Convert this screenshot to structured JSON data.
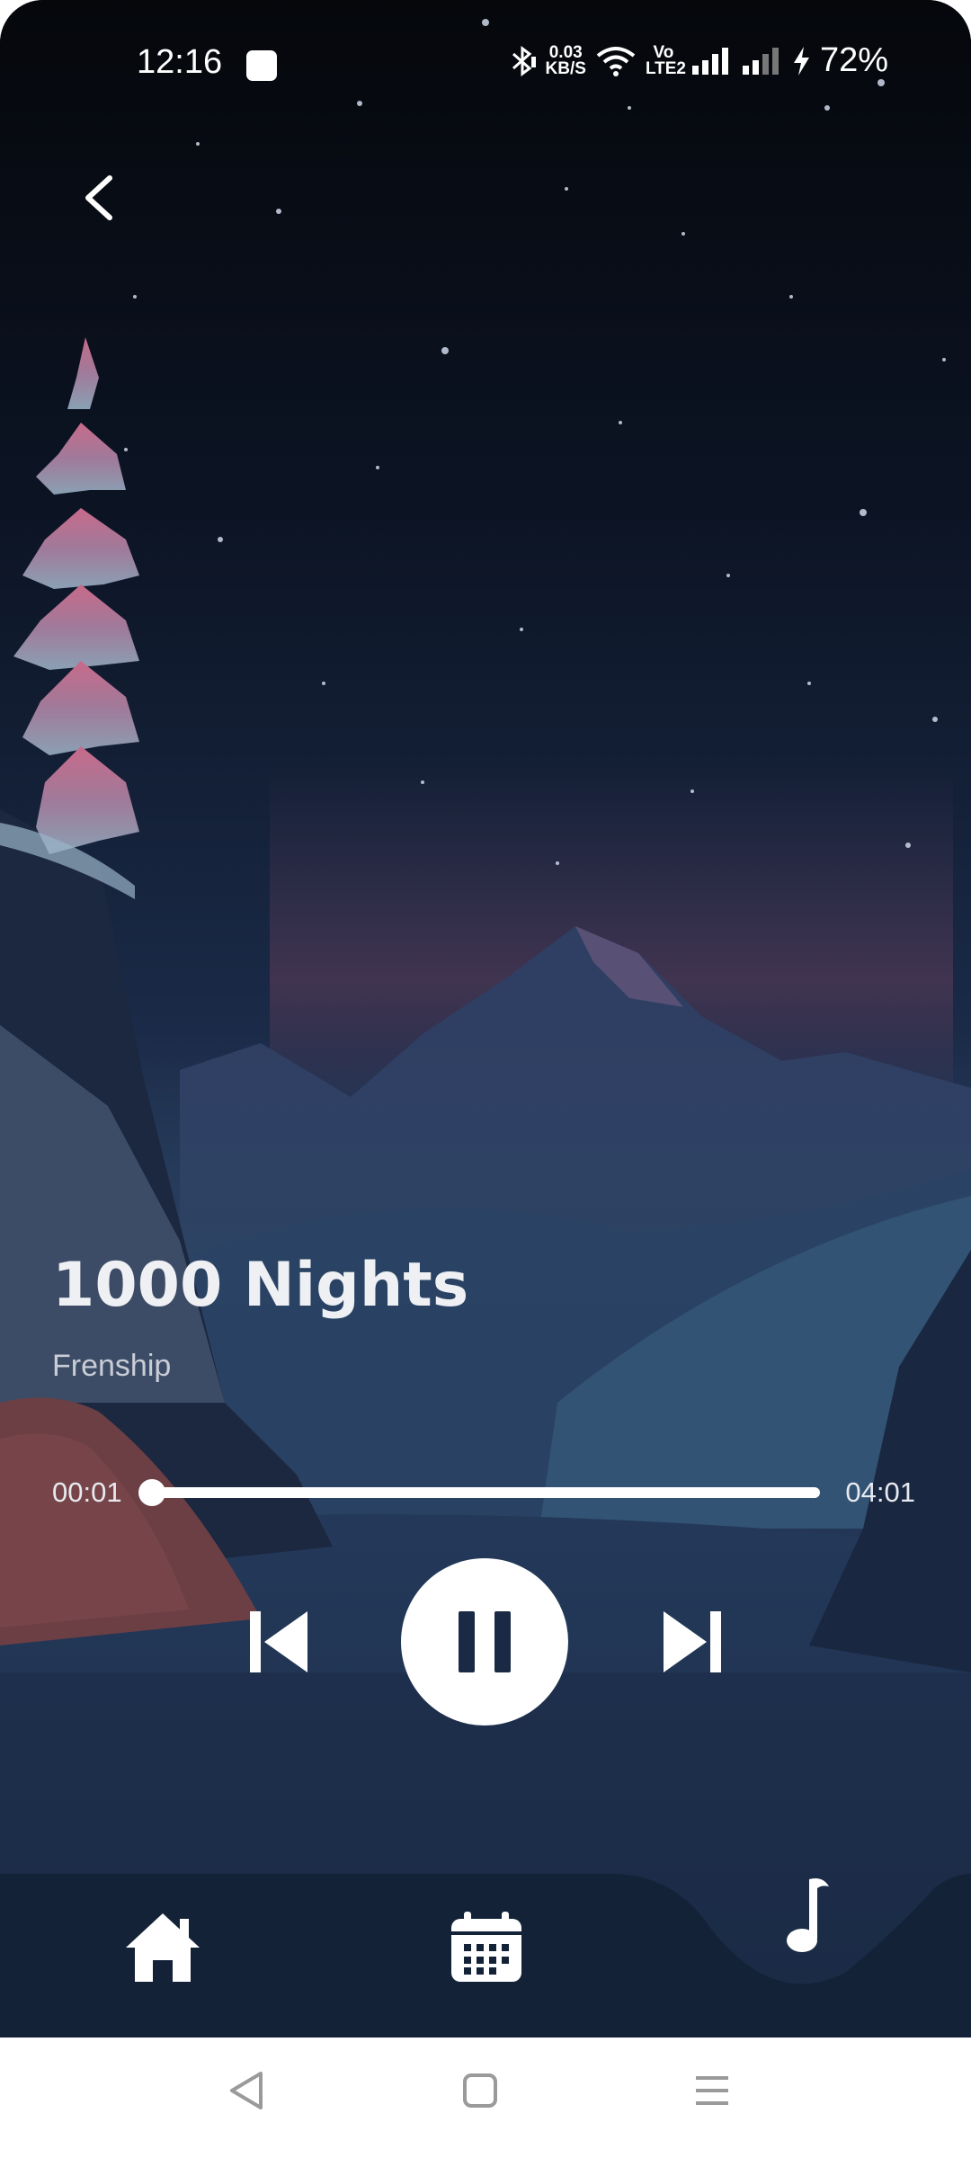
{
  "status_bar": {
    "time": "12:16",
    "net_speed_value": "0.03",
    "net_speed_unit": "KB/S",
    "volte_label": "Vo LTE2",
    "battery": "72%"
  },
  "player": {
    "song_title": "1000 Nights",
    "artist": "Frenship",
    "current_time": "00:01",
    "total_time": "04:01",
    "progress": 0.004,
    "state": "playing"
  },
  "bottom_nav": {
    "items": [
      {
        "icon": "home-icon",
        "active": false
      },
      {
        "icon": "calendar-icon",
        "active": false
      },
      {
        "icon": "music-note-icon",
        "active": true
      }
    ]
  },
  "system_nav": {
    "items": [
      {
        "icon": "back-triangle-icon"
      },
      {
        "icon": "home-square-icon"
      },
      {
        "icon": "recents-menu-icon"
      }
    ]
  },
  "colors": {
    "sky_top": "#05070b",
    "sky_mid": "#1a2b47",
    "mountain": "#2c3b5c",
    "nav_bg": "#142238",
    "accent_white": "#ffffff",
    "tent": "#6b3f44"
  }
}
